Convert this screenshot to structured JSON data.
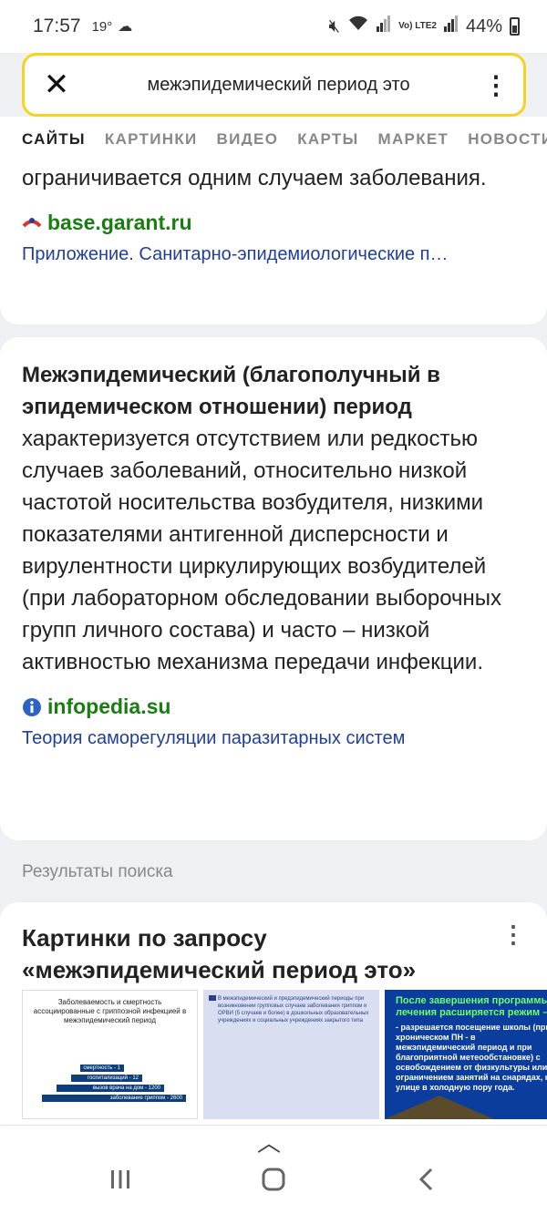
{
  "status": {
    "time": "17:57",
    "temperature": "19°",
    "network": "Vo) LTE2",
    "battery": "44%"
  },
  "search": {
    "query": "межэпидемический период это"
  },
  "tabs": [
    "САЙТЫ",
    "КАРТИНКИ",
    "ВИДЕО",
    "КАРТЫ",
    "МАРКЕТ",
    "НОВОСТИ"
  ],
  "results": [
    {
      "text": "ограничивается одним случаем заболевания.",
      "source": "base.garant.ru",
      "link": "Приложение. Санитарно-эпидемиологические п…"
    },
    {
      "bold": "Межэпидемический (благополучный в эпидемическом отношении) период",
      "text": " характеризуется отсутствием или редкостью случаев заболеваний, относительно низкой частотой носительства возбудителя, низкими показателями антигенной дисперсности и вирулентности циркулирующих возбудителей (при лабораторном обследовании выборочных групп личного состава) и часто – низкой активностью механизма передачи инфекции.",
      "source": "infopedia.su",
      "link": "Теория саморегуляции паразитарных систем"
    }
  ],
  "section_label": "Результаты поиска",
  "images": {
    "title": "Картинки по запросу «межэпидемический период это»",
    "thumb1": {
      "caption": "Заболеваемость и смертность ассоциированные с гриппозной инфекцией в межэпидемический период",
      "steps": [
        "смертность - 1",
        "госпитализаций - 12",
        "вызов врача на дом - 1200",
        "заболевание гриппом - 2600"
      ]
    },
    "thumb2": {
      "text": "В межэпидемический и предэпидемический периоды при возникновении групповых случаев заболевания гриппом и ОРВИ (5 случаев и более) в дошкольных образовательных учреждениях и социальных учреждениях закрытого типа"
    },
    "thumb3": {
      "title": "После завершения программы лечения расширяется режим –",
      "body": "- разрешается посещение школы (при хроническом ПН - в межэпидемический период и при благоприятной метеообстановке) с освобождением от физкультуры или ограничением занятий на снарядах, на улице в холодную пору года."
    }
  }
}
